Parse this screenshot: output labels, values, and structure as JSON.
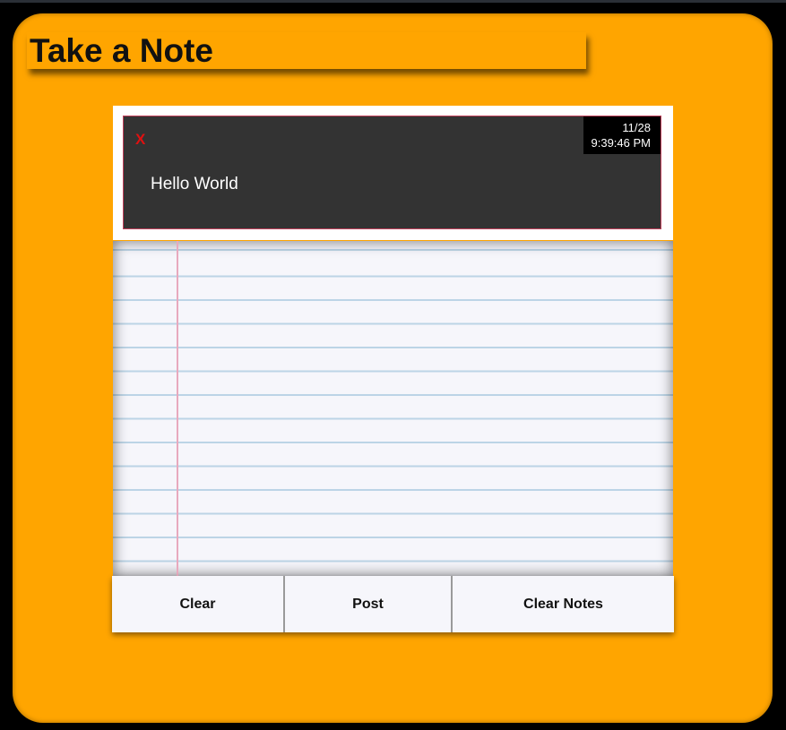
{
  "app": {
    "title": "Take a Note"
  },
  "notes": [
    {
      "close_label": "X",
      "date": "11/28",
      "time": "9:39:46 PM",
      "text": "Hello World"
    }
  ],
  "editor": {
    "value": ""
  },
  "buttons": {
    "clear": "Clear",
    "post": "Post",
    "clear_notes": "Clear Notes"
  },
  "colors": {
    "background": "#000000",
    "app": "#ffa500",
    "note_card": "#333333",
    "close": "#e01010",
    "paper": "#f6f6fb",
    "paper_lines": "#bcd4e6",
    "paper_margin": "#e8a9be"
  }
}
